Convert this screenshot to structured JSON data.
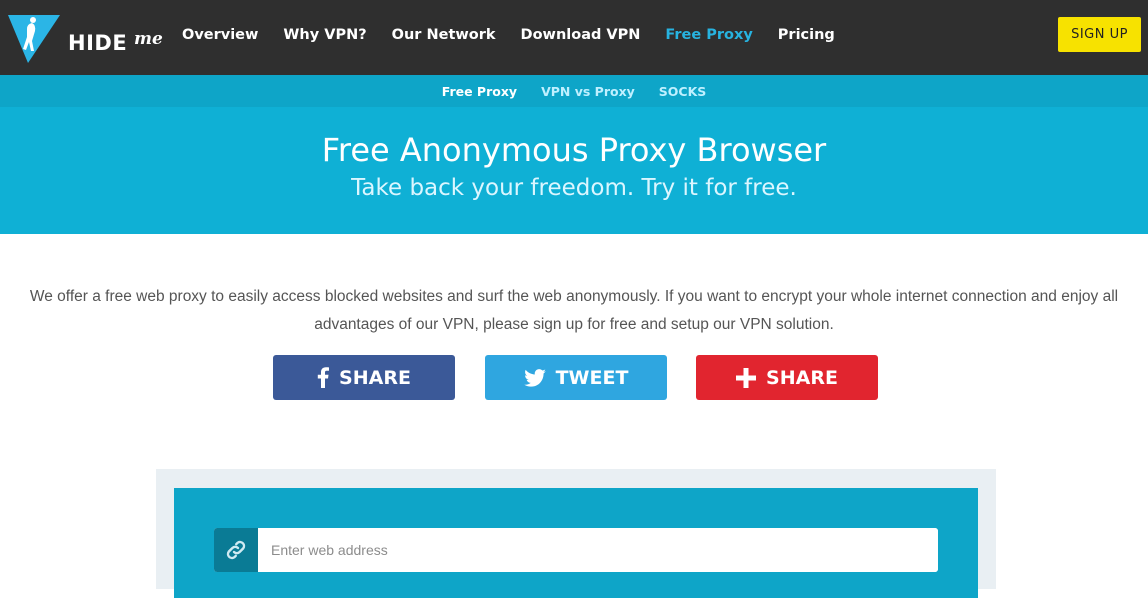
{
  "brand": {
    "name": "HIDE",
    "suffix": "me"
  },
  "nav": {
    "items": [
      {
        "label": "Overview",
        "active": false
      },
      {
        "label": "Why VPN?",
        "active": false
      },
      {
        "label": "Our Network",
        "active": false
      },
      {
        "label": "Download VPN",
        "active": false
      },
      {
        "label": "Free Proxy",
        "active": true
      },
      {
        "label": "Pricing",
        "active": false
      }
    ],
    "signup_label": "SIGN UP"
  },
  "subnav": {
    "items": [
      {
        "label": "Free Proxy",
        "active": true
      },
      {
        "label": "VPN vs Proxy",
        "active": false
      },
      {
        "label": "SOCKS",
        "active": false
      }
    ]
  },
  "hero": {
    "title": "Free Anonymous Proxy Browser",
    "subtitle": "Take back your freedom. Try it for free."
  },
  "intro": {
    "line1": "We offer a free web proxy to easily access blocked websites and surf the web anonymously. If you want to encrypt your whole internet connection and enjoy all",
    "line2": "advantages of our VPN, please sign up for free and setup our VPN solution."
  },
  "share": {
    "facebook": {
      "label": "SHARE",
      "icon": "facebook-icon",
      "color": "#3b5998"
    },
    "twitter": {
      "label": "TWEET",
      "icon": "twitter-icon",
      "color": "#2fa6e0"
    },
    "more": {
      "label": "SHARE",
      "icon": "plus-icon",
      "color": "#e1252f"
    }
  },
  "proxy_form": {
    "url_placeholder": "Enter web address",
    "url_value": "",
    "icon": "link-icon"
  },
  "colors": {
    "topbar": "#2f2f2f",
    "accent": "#0fb0d5",
    "active_link": "#27b3e0",
    "signup": "#f7e200"
  }
}
